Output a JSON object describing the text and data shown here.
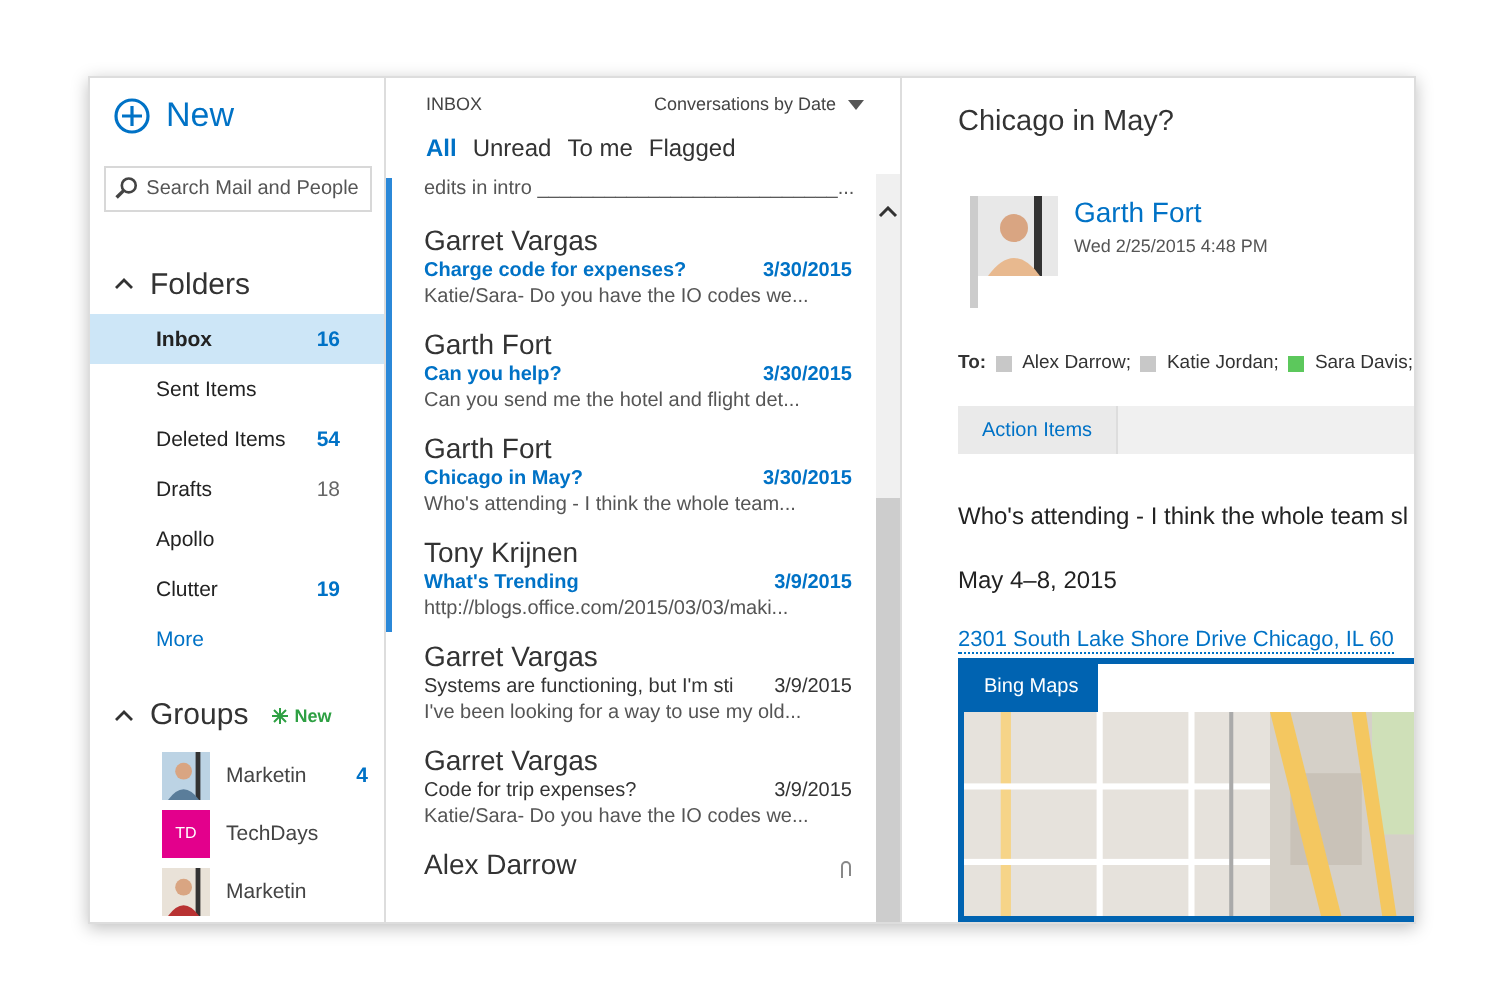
{
  "nav": {
    "new_label": "New",
    "search": {
      "placeholder": "Search Mail and People"
    },
    "folders": {
      "title": "Folders",
      "expanded": true,
      "items": [
        {
          "label": "Inbox",
          "count": "16",
          "unread": true,
          "selected": true
        },
        {
          "label": "Sent Items",
          "selected": false
        },
        {
          "label": "Deleted Items",
          "count": "54",
          "unread": true,
          "selected": false
        },
        {
          "label": "Drafts",
          "count": "18",
          "unread": false,
          "selected": false
        },
        {
          "label": "Apollo",
          "selected": false
        },
        {
          "label": "Clutter",
          "count": "19",
          "unread": true,
          "selected": false
        }
      ],
      "more": "More"
    },
    "groups": {
      "title": "Groups",
      "expanded": true,
      "badge": "New",
      "items": [
        {
          "kind": "picture",
          "label": "Marketin",
          "count": "4"
        },
        {
          "kind": "initials",
          "initials": "TD",
          "color": "#e3008c",
          "label": "TechDays"
        },
        {
          "kind": "picture",
          "label": "Marketin"
        }
      ]
    }
  },
  "list": {
    "folder": "INBOX",
    "sort": "Conversations by Date",
    "filters": [
      {
        "label": "All",
        "selected": true
      },
      {
        "label": "Unread",
        "selected": false
      },
      {
        "label": "To me",
        "selected": false
      },
      {
        "label": "Flagged",
        "selected": false
      }
    ],
    "messages": [
      {
        "preview": "edits in intro ___________________________...",
        "unread": true
      },
      {
        "sender": "Garret Vargas",
        "subject": "Charge code for expenses?",
        "date": "3/30/2015",
        "preview": "Katie/Sara- Do you have the IO codes we...",
        "unread": true
      },
      {
        "sender": "Garth Fort",
        "subject": "Can you help?",
        "date": "3/30/2015",
        "preview": "Can you send me the hotel and flight det...",
        "unread": true
      },
      {
        "sender": "Garth Fort",
        "subject": "Chicago in May?",
        "date": "3/30/2015",
        "preview": "Who's attending - I think the whole team...",
        "unread": true
      },
      {
        "sender": "Tony Krijnen",
        "subject": "What's Trending",
        "date": "3/9/2015",
        "preview": "http://blogs.office.com/2015/03/03/maki...",
        "unread": true
      },
      {
        "sender": "Garret Vargas",
        "subject": "Systems are functioning, but I'm sti",
        "date": "3/9/2015",
        "preview": "I've been looking for a way to use my old...",
        "unread": false
      },
      {
        "sender": "Garret Vargas",
        "subject": "Code for trip expenses?",
        "date": "3/9/2015",
        "preview": "Katie/Sara- Do you have the IO codes we...",
        "unread": false
      },
      {
        "sender": "Alex Darrow",
        "unread": false,
        "attachment": true
      }
    ]
  },
  "reading": {
    "subject": "Chicago in May?",
    "sender": "Garth Fort",
    "sent": "Wed 2/25/2015 4:48 PM",
    "to_label": "To:",
    "recipients": [
      {
        "name": "Alex Darrow;",
        "color": "#c8c8c8"
      },
      {
        "name": "Katie Jordan;",
        "color": "#c8c8c8"
      },
      {
        "name": "Sara Davis;",
        "color": "#5cc85c"
      }
    ],
    "tabs": [
      {
        "label": "Action Items",
        "selected": true
      }
    ],
    "body": [
      "Who's attending - I think the whole team sl",
      "May 4–8, 2015"
    ],
    "link": "2301 South Lake Shore Drive Chicago, IL 60",
    "map": {
      "title": "Bing Maps"
    }
  }
}
